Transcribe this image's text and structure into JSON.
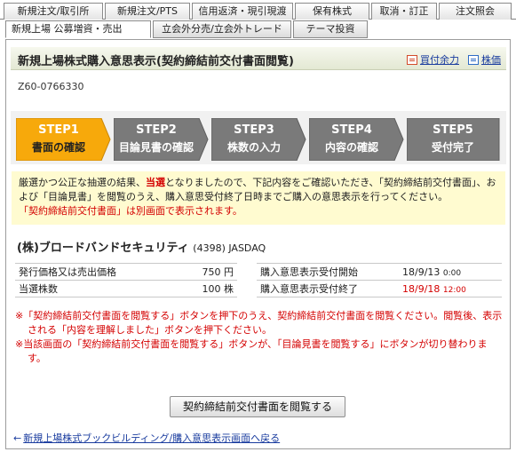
{
  "top_tabs": [
    "新規注文/取引所",
    "新規注文/PTS",
    "信用返済・現引現渡",
    "保有株式",
    "取消・訂正",
    "注文照会"
  ],
  "sub_tabs": [
    "新規上場 公募増資・売出",
    "立会外分売/立会外トレード",
    "テーマ投資"
  ],
  "header": {
    "title": "新規上場株式購入意思表示(契約締結前交付書面閲覧)",
    "link_buying_power": "買付余力",
    "link_stock_price": "株価"
  },
  "doc_id": "Z60-0766330",
  "steps": [
    {
      "num": "STEP1",
      "label": "書面の確認"
    },
    {
      "num": "STEP2",
      "label": "目論見書の確認"
    },
    {
      "num": "STEP3",
      "label": "株数の入力"
    },
    {
      "num": "STEP4",
      "label": "内容の確認"
    },
    {
      "num": "STEP5",
      "label": "受付完了"
    }
  ],
  "notice": {
    "part1": "厳選かつ公正な抽選の結果、",
    "highlight": "当選",
    "part2": "となりましたので、下記内容をご確認いただき、「契約締結前交付書面」、および「目論見書」を閲覧のうえ、購入意思受付終了日時までご購入の意思表示を行ってください。",
    "line3": "「契約締結前交付書面」は別画面で表示されます。"
  },
  "company": {
    "name": "(株)ブロードバンドセキュリティ",
    "code": "(4398) JASDAQ"
  },
  "info_rows": [
    {
      "label": "発行価格又は売出価格",
      "value": "750 円",
      "label2": "購入意思表示受付開始",
      "date": "18/9/13",
      "time": "0:00",
      "red": false
    },
    {
      "label": "当選株数",
      "value": "100 株",
      "label2": "購入意思表示受付終了",
      "date": "18/9/18",
      "time": "12:00",
      "red": true
    }
  ],
  "warnings": [
    "※「契約締結前交付書面を閲覧する」ボタンを押下のうえ、契約締結前交付書面を閲覧ください。閲覧後、表示される「内容を理解しました」ボタンを押下ください。",
    "※当該画面の「契約締結前交付書面を閲覧する」ボタンが、「目論見書を閲覧する」にボタンが切り替わります。"
  ],
  "view_button": "契約締結前交付書面を閲覧する",
  "back_link": "新規上場株式ブックビルディング/購入意思表示画面へ戻る",
  "colors": {
    "step_active": "#f7a90b",
    "step_inactive": "#7a7a7a",
    "notice_bg": "#fffbd0",
    "warn": "#d40000"
  }
}
